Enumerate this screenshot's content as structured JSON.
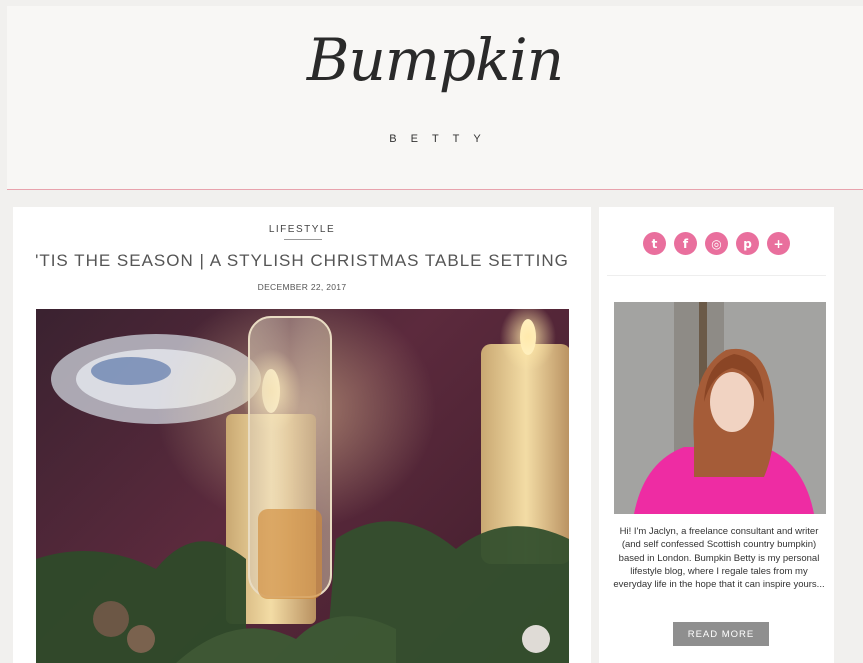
{
  "header": {
    "logo_script": "Bumpkin",
    "logo_sub": "BETTY"
  },
  "post": {
    "category": "LIFESTYLE",
    "title": "'TIS THE SEASON | A STYLISH CHRISTMAS TABLE SETTING",
    "date": "DECEMBER 22, 2017"
  },
  "sidebar": {
    "social": [
      {
        "name": "twitter-icon",
        "glyph": "t"
      },
      {
        "name": "facebook-icon",
        "glyph": "f"
      },
      {
        "name": "instagram-icon",
        "glyph": "◎"
      },
      {
        "name": "pinterest-icon",
        "glyph": "p"
      },
      {
        "name": "plus-icon",
        "glyph": "+"
      }
    ],
    "bio": "Hi! I'm Jaclyn, a freelance consultant and writer (and self confessed Scottish country bumpkin) based in London. Bumpkin Betty is my personal lifestyle blog, where I regale tales from my everyday life in the hope that it can inspire yours...",
    "read_more": "READ MORE"
  },
  "colors": {
    "accent_pink": "#e96f9d",
    "header_rule": "#e8a3ad",
    "button_gray": "#8f8f8f"
  }
}
